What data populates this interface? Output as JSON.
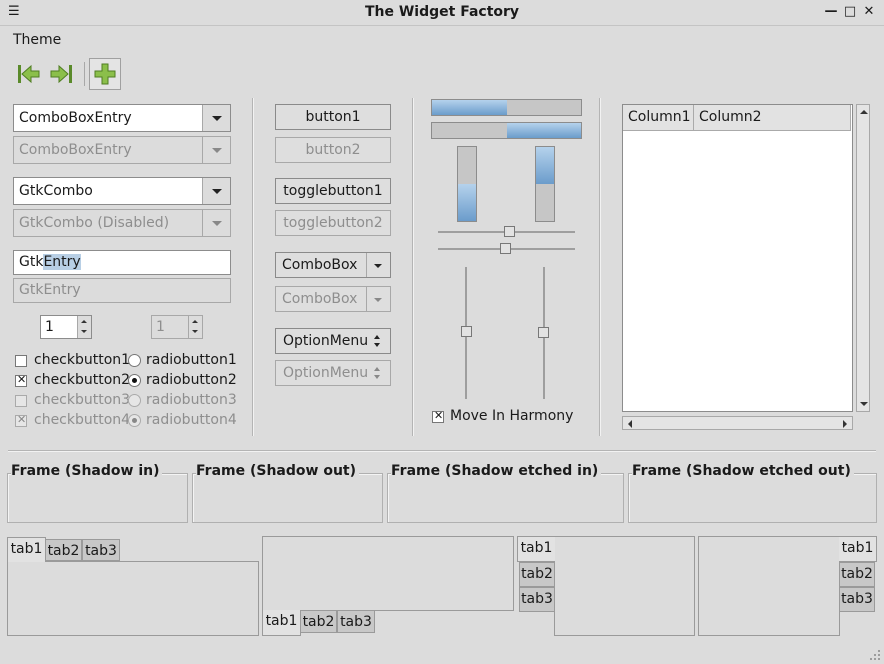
{
  "window": {
    "title": "The Widget Factory"
  },
  "menubar": {
    "theme": "Theme"
  },
  "toolbar": {
    "back_icon": "go-first-icon",
    "forward_icon": "go-last-icon",
    "add_icon": "add-icon"
  },
  "entries": {
    "combo_entry_1": "ComboBoxEntry",
    "combo_entry_2": "ComboBoxEntry",
    "gtk_combo_1": "GtkCombo",
    "gtk_combo_2": "GtkCombo (Disabled)",
    "entry_1_plain": "Gtk",
    "entry_1_selected": "Entry",
    "entry_2": "GtkEntry"
  },
  "spinners": {
    "enabled_value": "1",
    "disabled_value": "1"
  },
  "checks": [
    {
      "label": "checkbutton1",
      "checked": false,
      "disabled": false
    },
    {
      "label": "checkbutton2",
      "checked": true,
      "disabled": false
    },
    {
      "label": "checkbutton3",
      "checked": false,
      "disabled": true
    },
    {
      "label": "checkbutton4",
      "checked": true,
      "disabled": true
    }
  ],
  "radios": [
    {
      "label": "radiobutton1",
      "selected": false,
      "disabled": false
    },
    {
      "label": "radiobutton2",
      "selected": true,
      "disabled": false
    },
    {
      "label": "radiobutton3",
      "selected": false,
      "disabled": true
    },
    {
      "label": "radiobutton4",
      "selected": true,
      "disabled": true
    }
  ],
  "buttons": {
    "button1": "button1",
    "button2": "button2",
    "toggle1": "togglebutton1",
    "toggle2": "togglebutton2",
    "combobox1": "ComboBox",
    "combobox2": "ComboBox",
    "optionmenu1": "OptionMenu",
    "optionmenu2": "OptionMenu"
  },
  "progress": {
    "h1": 0.5,
    "h2": 0.5,
    "v1": 0.5,
    "v2": 0.5
  },
  "harmony": {
    "label": "Move In Harmony",
    "checked": true
  },
  "tree": {
    "column1": "Column1",
    "column2": "Column2"
  },
  "frames": [
    "Frame (Shadow in)",
    "Frame (Shadow out)",
    "Frame (Shadow etched in)",
    "Frame (Shadow etched out)"
  ],
  "tabs": [
    "tab1",
    "tab2",
    "tab3"
  ],
  "colors": {
    "accent": "#6b9ccb",
    "window_bg": "#dcdcdc"
  }
}
